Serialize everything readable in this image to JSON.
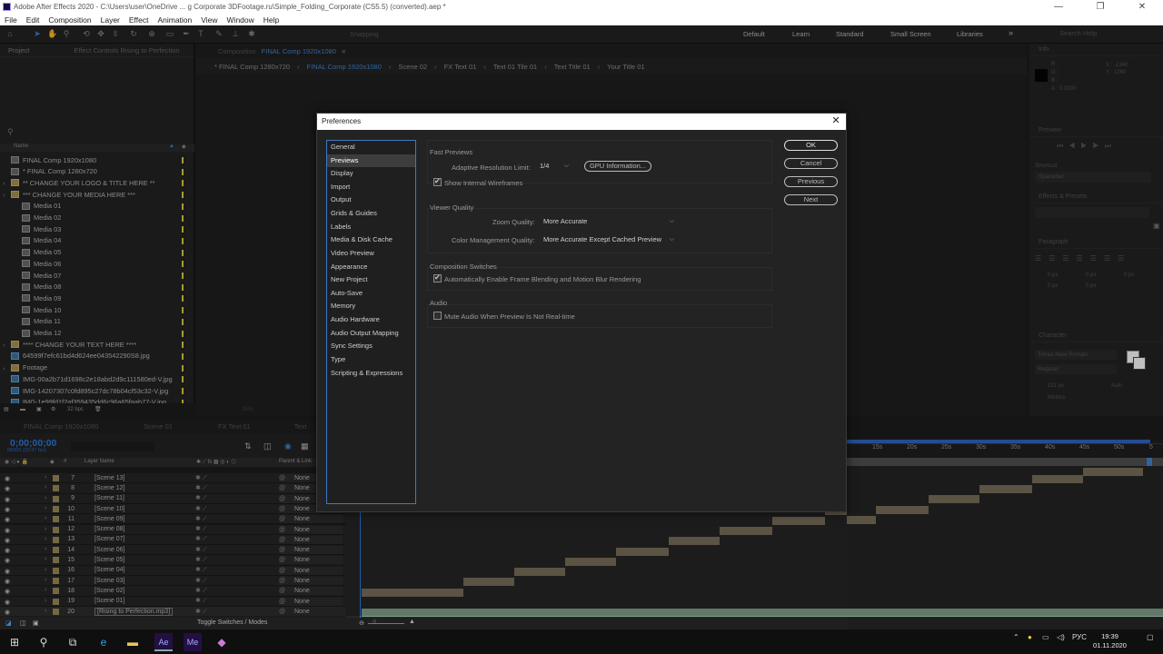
{
  "window": {
    "title": "Adobe After Effects 2020 - C:\\Users\\user\\OneDrive ... g Corporate 3DFootage.ru\\Simple_Folding_Corporate (CS5.5) (converted).aep *",
    "min": "—",
    "max": "❐",
    "close": "✕"
  },
  "menu": [
    "File",
    "Edit",
    "Composition",
    "Layer",
    "Effect",
    "Animation",
    "View",
    "Window",
    "Help"
  ],
  "toolbar": {
    "snapping": "Snapping",
    "workspaces": [
      "Default",
      "Learn",
      "Standard",
      "Small Screen",
      "Libraries"
    ],
    "more": "»",
    "search_placeholder": "Search Help"
  },
  "project_panel": {
    "tabs": [
      "Project",
      "Effect Controls Rising to Perfection"
    ],
    "col_name": "Name",
    "items": [
      {
        "name": "FINAL Comp 1920x1080",
        "type": "comp"
      },
      {
        "name": "* FINAL Comp 1280x720",
        "type": "comp"
      },
      {
        "name": "** CHANGE YOUR LOGO & TITLE HERE **",
        "type": "folder"
      },
      {
        "name": "*** CHANGE YOUR MEDIA HERE ***",
        "type": "folder"
      },
      {
        "name": "Media 01",
        "type": "comp"
      },
      {
        "name": "Media 02",
        "type": "comp"
      },
      {
        "name": "Media 03",
        "type": "comp"
      },
      {
        "name": "Media 04",
        "type": "comp"
      },
      {
        "name": "Media 05",
        "type": "comp"
      },
      {
        "name": "Media 06",
        "type": "comp"
      },
      {
        "name": "Media 07",
        "type": "comp"
      },
      {
        "name": "Media 08",
        "type": "comp"
      },
      {
        "name": "Media 09",
        "type": "comp"
      },
      {
        "name": "Media 10",
        "type": "comp"
      },
      {
        "name": "Media 11",
        "type": "comp"
      },
      {
        "name": "Media 12",
        "type": "comp"
      },
      {
        "name": "**** CHANGE YOUR TEXT HERE ****",
        "type": "folder"
      },
      {
        "name": "64599f7efc61bd4d624ee043542290S8.jpg",
        "type": "img"
      },
      {
        "name": "Footage",
        "type": "folder"
      },
      {
        "name": "IMG-00a2b71d1698c2e18abd2d9c111580ed-V.jpg",
        "type": "img"
      },
      {
        "name": "IMG-14207307c0fd895c27dc78b04cf53c32-V.jpg",
        "type": "img"
      },
      {
        "name": "IMG-1e99fd1f2af359435dd6c96a65faab77-V.jpg",
        "type": "img"
      }
    ],
    "bpc": "32 bpc"
  },
  "composition": {
    "tab_label": "Composition",
    "tab_name": "FINAL Comp 1920x1080",
    "breadcrumbs": [
      "* FINAL Comp 1280x720",
      "FINAL Comp 1920x1080",
      "Scene 02",
      "FX Text 01",
      "Text 01 Tile 01",
      "Text Title 01",
      "Your Title 01"
    ],
    "active_crumb": 1,
    "zoom": "25%"
  },
  "right_panels": {
    "info": "Info",
    "info_values": {
      "x": "X : -1340",
      "y": "Y : 1360",
      "r": "R :",
      "g": "G :",
      "b": "B :",
      "a": "A : 0.0000"
    },
    "preview": "Preview",
    "shortcut": "Shortcut",
    "shortcut_value": "Spacebar",
    "effects_presets": "Effects & Presets",
    "paragraph": "Paragraph",
    "px_values": [
      "0 px",
      "0 px",
      "0 px",
      "0 px",
      "0 px"
    ],
    "character": "Character",
    "font": "Times New Roman",
    "style": "Regular",
    "size": "121 px",
    "leading": "Auto",
    "kerning": "Metrics"
  },
  "timeline": {
    "tabs": [
      "FINAL Comp 1920x1080",
      "Scene 01",
      "FX Text 01",
      "Text"
    ],
    "timecode": "0;00;00;00",
    "fps": "00000 (29.97 fps)",
    "search_placeholder": "",
    "col_layer_name": "Layer Name",
    "col_parent": "Parent & Link",
    "ruler_ticks": [
      "15s",
      "20s",
      "25s",
      "30s",
      "35s",
      "40s",
      "45s",
      "50s"
    ],
    "layers": [
      {
        "num": "7",
        "name": "[Scene 13]",
        "parent": "None"
      },
      {
        "num": "8",
        "name": "[Scene 12]",
        "parent": "None"
      },
      {
        "num": "9",
        "name": "[Scene 11]",
        "parent": "None"
      },
      {
        "num": "10",
        "name": "[Scene 10]",
        "parent": "None"
      },
      {
        "num": "11",
        "name": "[Scene 09]",
        "parent": "None"
      },
      {
        "num": "12",
        "name": "[Scene 08]",
        "parent": "None"
      },
      {
        "num": "13",
        "name": "[Scene 07]",
        "parent": "None"
      },
      {
        "num": "14",
        "name": "[Scene 06]",
        "parent": "None"
      },
      {
        "num": "15",
        "name": "[Scene 05]",
        "parent": "None"
      },
      {
        "num": "16",
        "name": "[Scene 04]",
        "parent": "None"
      },
      {
        "num": "17",
        "name": "[Scene 03]",
        "parent": "None"
      },
      {
        "num": "18",
        "name": "[Scene 02]",
        "parent": "None"
      },
      {
        "num": "19",
        "name": "[Scene 01]",
        "parent": "None"
      },
      {
        "num": "20",
        "name": "[Rising to Perfection.mp3]",
        "parent": "None"
      }
    ],
    "toggle_label": "Toggle Switches / Modes"
  },
  "preferences": {
    "title": "Preferences",
    "close": "✕",
    "categories": [
      "General",
      "Previews",
      "Display",
      "Import",
      "Output",
      "Grids & Guides",
      "Labels",
      "Media & Disk Cache",
      "Video Preview",
      "Appearance",
      "New Project",
      "Auto-Save",
      "Memory",
      "Audio Hardware",
      "Audio Output Mapping",
      "Sync Settings",
      "Type",
      "Scripting & Expressions"
    ],
    "selected_category": 1,
    "buttons": {
      "ok": "OK",
      "cancel": "Cancel",
      "previous": "Previous",
      "next": "Next"
    },
    "fast_previews": {
      "title": "Fast Previews",
      "adaptive_label": "Adaptive Resolution Limit:",
      "adaptive_value": "1/4",
      "gpu_button": "GPU Information...",
      "wireframes_label": "Show Internal Wireframes",
      "wireframes_checked": true
    },
    "viewer_quality": {
      "title": "Viewer Quality",
      "zoom_label": "Zoom Quality:",
      "zoom_value": "More Accurate",
      "color_label": "Color Management Quality:",
      "color_value": "More Accurate Except Cached Preview"
    },
    "composition_switches": {
      "title": "Composition Switches",
      "blend_label": "Automatically Enable Frame Blending and Motion Blur Rendering",
      "blend_checked": true
    },
    "audio": {
      "title": "Audio",
      "mute_label": "Mute Audio When Preview Is Not Real-time",
      "mute_checked": false
    }
  },
  "taskbar": {
    "lang": "РУС",
    "time": "19:39",
    "date": "01.11.2020"
  }
}
